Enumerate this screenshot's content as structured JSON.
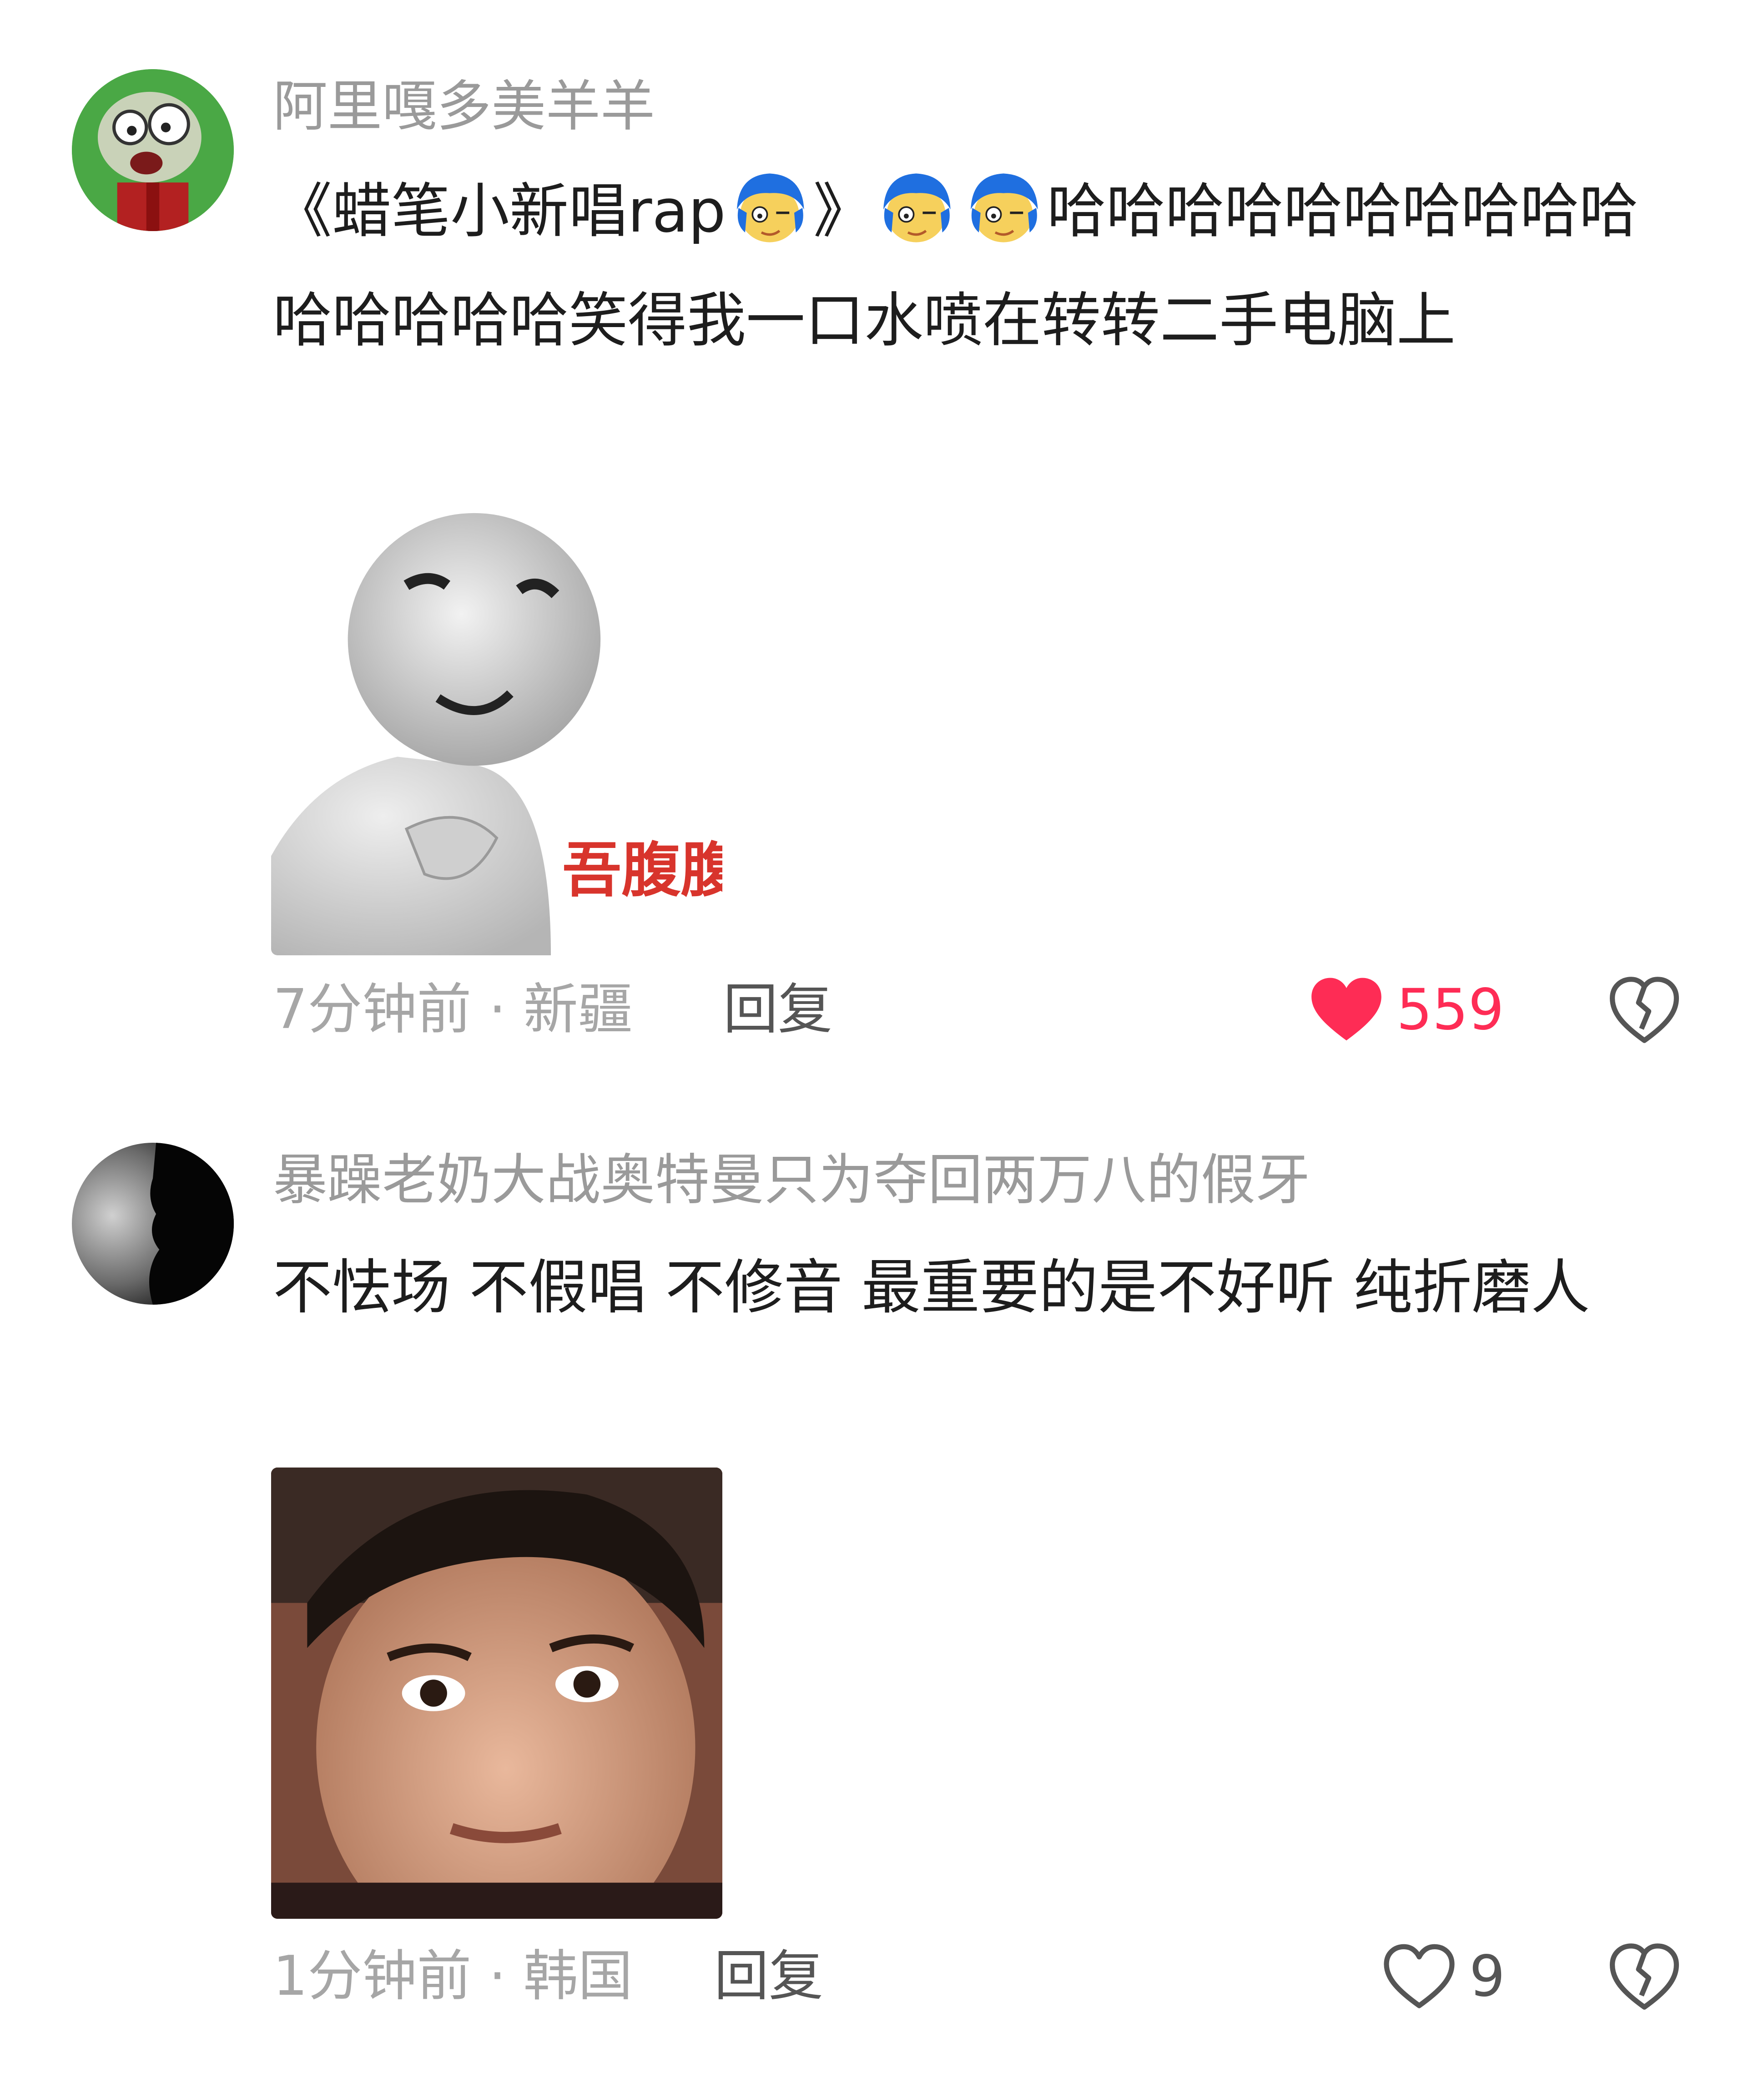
{
  "comments": [
    {
      "username": "阿里嘎多美羊羊",
      "text_parts": [
        "《蜡笔小新唱rap",
        "》",
        "哈哈哈哈哈哈哈哈哈哈哈哈哈哈哈笑得我一口水喷在转转二手电脑上"
      ],
      "sticker_caption": "吾腹腹",
      "time_location": "7分钟前 · 新疆",
      "reply_label": "回复",
      "like_count": "559",
      "liked": true,
      "avatar_icon": "zombie-avatar-icon",
      "inline_emoji_icon": "blue-hair-face-emoji-icon"
    },
    {
      "username": "暴躁老奶大战奥特曼只为夺回两万八的假牙",
      "text": "不怯场 不假唱 不修音 最重要的是不好听 纯折磨人",
      "time_location": "1分钟前 · 韩国",
      "reply_label": "回复",
      "like_count": "9",
      "liked": false,
      "avatar_icon": "silhouette-avatar-icon"
    }
  ],
  "colors": {
    "username": "#9a9a9a",
    "text": "#1d1d1d",
    "meta": "#a6a6a6",
    "like_active": "#fe2c55",
    "icon_gray": "#555555"
  }
}
